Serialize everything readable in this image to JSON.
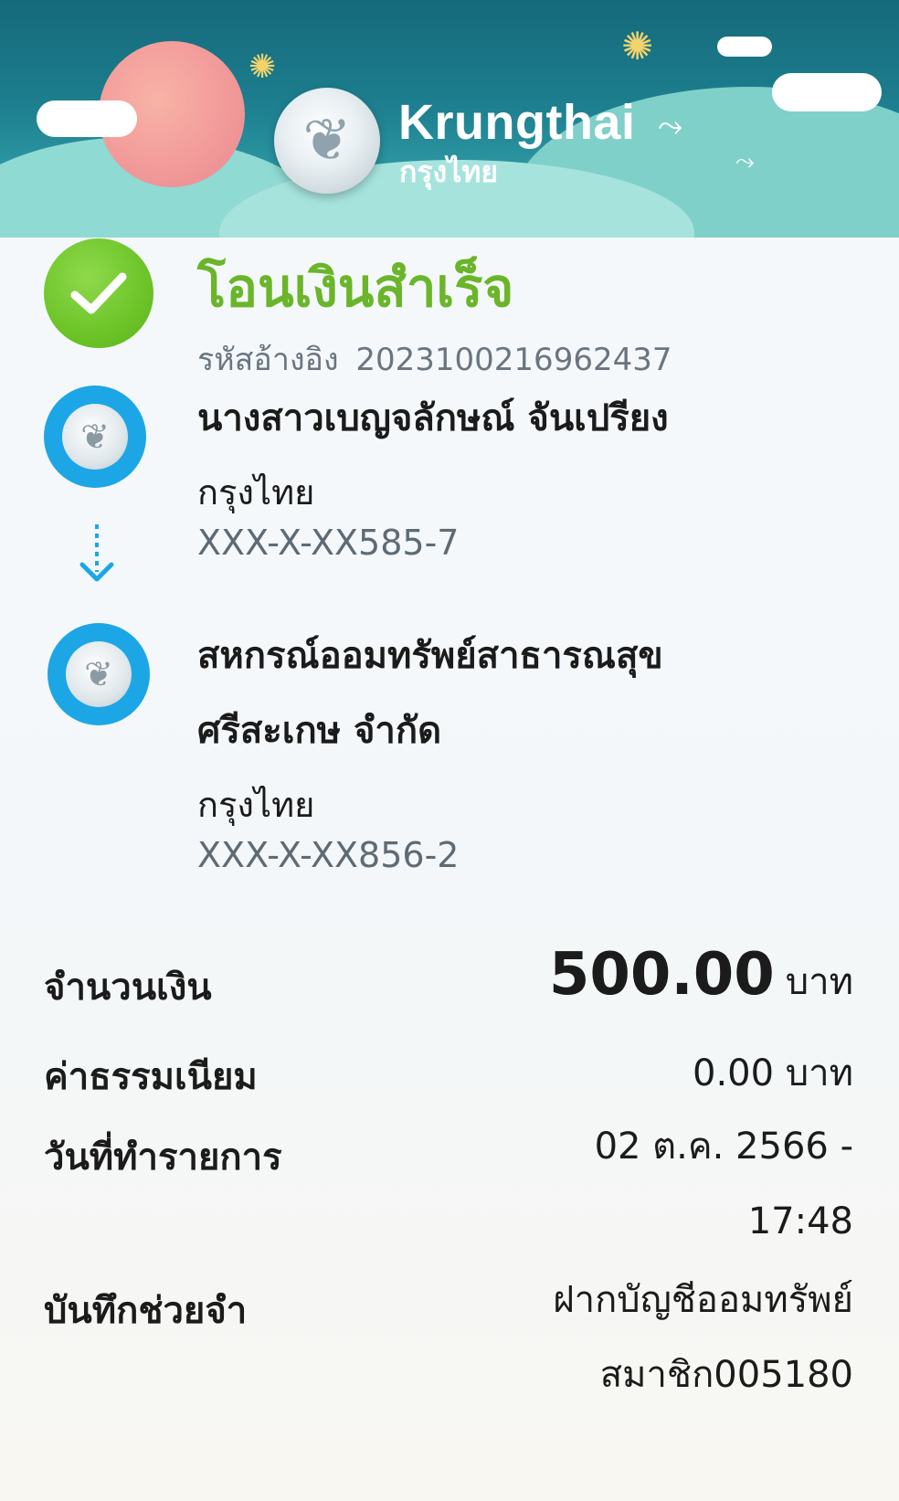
{
  "header": {
    "brand_en": "Krungthai",
    "brand_th": "กรุงไทย"
  },
  "status": {
    "title": "โอนเงินสำเร็จ",
    "ref_label": "รหัสอ้างอิง",
    "ref_value": "2023100216962437",
    "icon": "check-icon",
    "color": "#6ab52a"
  },
  "from": {
    "name": "นางสาวเบญจลักษณ์ จันเปรียง",
    "bank": "กรุงไทย",
    "account": "XXX-X-XX585-7"
  },
  "to": {
    "name_line1": "สหกรณ์ออมทรัพย์สาธารณสุข",
    "name_line2": "ศรีสะเกษ จำกัด",
    "bank": "กรุงไทย",
    "account": "XXX-X-XX856-2"
  },
  "details": {
    "amount_label": "จำนวนเงิน",
    "amount_value": "500.00",
    "amount_unit": "บาท",
    "fee_label": "ค่าธรรมเนียม",
    "fee_value": "0.00 บาท",
    "date_label": "วันที่ทำรายการ",
    "date_line1": "02 ต.ค. 2566 -",
    "date_line2": "17:48",
    "memo_label": "บันทึกช่วยจำ",
    "memo_line1": "ฝากบัญชีออมทรัพย์",
    "memo_line2": "สมาชิก005180"
  },
  "colors": {
    "accent_blue": "#1ca6e6",
    "header_teal": "#15697a"
  }
}
